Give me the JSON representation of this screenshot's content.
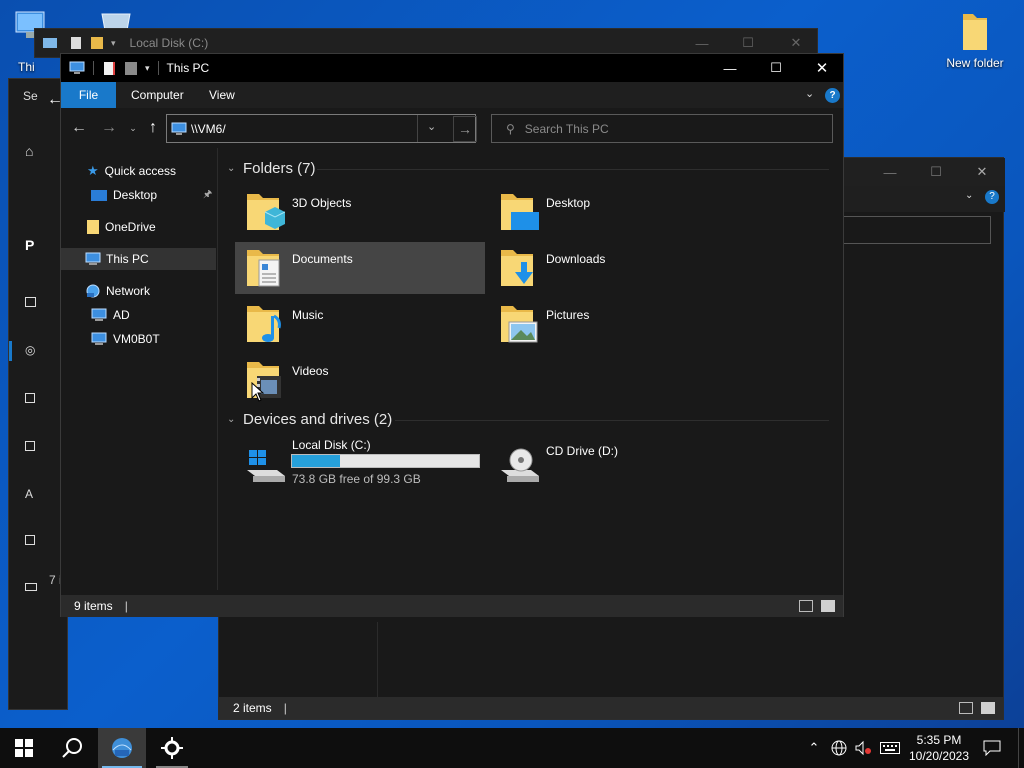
{
  "desktop": {
    "icons": [
      {
        "label": "Thi"
      },
      {
        "label": "New folder"
      }
    ]
  },
  "settings_window": {
    "title_fragment": "Se",
    "heading_fragment": "P",
    "status_fragment": "7 i"
  },
  "back_window": {
    "title": "Local Disk (C:)",
    "status": "2 items"
  },
  "explorer": {
    "title": "This PC",
    "ribbon": {
      "file": "File",
      "computer": "Computer",
      "view": "View"
    },
    "address": "\\\\VM6/",
    "search_placeholder": "Search This PC",
    "nav": [
      {
        "label": "Quick access"
      },
      {
        "label": "Desktop"
      },
      {
        "label": "OneDrive"
      },
      {
        "label": "This PC"
      },
      {
        "label": "Network"
      },
      {
        "label": "AD"
      },
      {
        "label": "VM0B0T"
      }
    ],
    "folders_header": "Folders (7)",
    "folders": [
      {
        "label": "3D Objects"
      },
      {
        "label": "Desktop"
      },
      {
        "label": "Documents"
      },
      {
        "label": "Downloads"
      },
      {
        "label": "Music"
      },
      {
        "label": "Pictures"
      },
      {
        "label": "Videos"
      }
    ],
    "drives_header": "Devices and drives (2)",
    "drives": [
      {
        "label": "Local Disk (C:)",
        "free": "73.8 GB free of 99.3 GB",
        "used_fraction": 0.257
      },
      {
        "label": "CD Drive (D:)"
      }
    ],
    "status": "9 items"
  },
  "taskbar": {
    "time": "5:35 PM",
    "date": "10/20/2023"
  },
  "colors": {
    "accent": "#1979ca",
    "selection": "#454545",
    "window_bg": "#191919"
  }
}
